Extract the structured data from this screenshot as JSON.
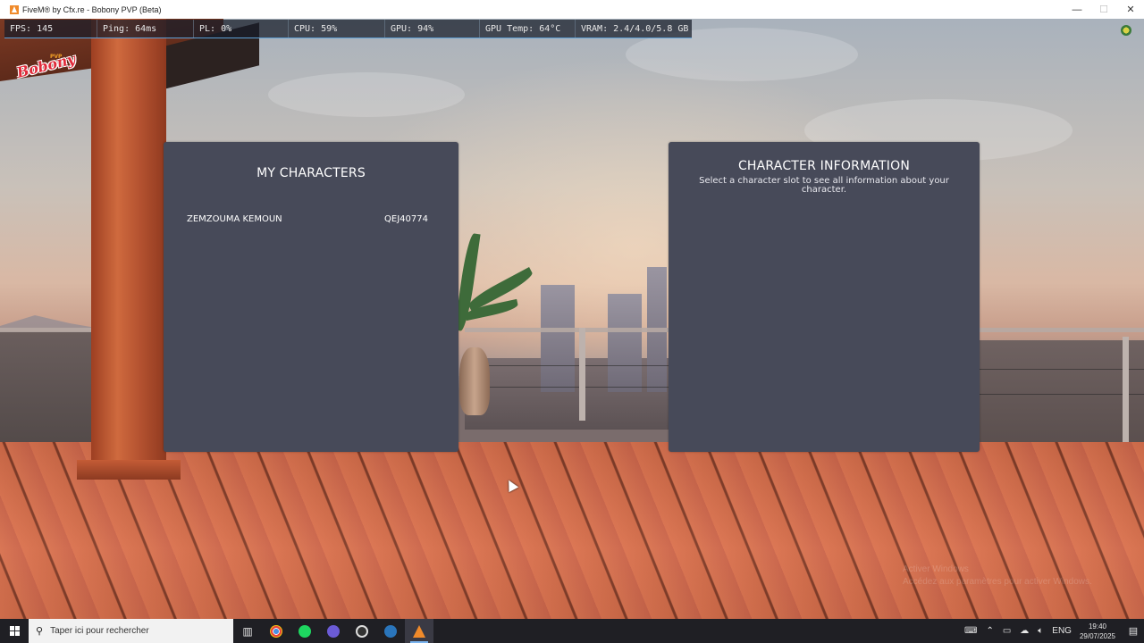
{
  "window": {
    "title": "FiveM® by Cfx.re - Bobony PVP (Beta)",
    "minimize": "—",
    "maximize": "☐",
    "close": "✕"
  },
  "hud": {
    "fps": "FPS: 145",
    "ping": "Ping: 64ms",
    "pl": "PL: 0%",
    "cpu": "CPU: 59%",
    "gpu": "GPU: 94%",
    "gpu_temp": "GPU Temp: 64°C",
    "vram": "VRAM: 2.4/4.0/5.8 GB"
  },
  "logo": {
    "text": "Bobony",
    "sup": "PVP"
  },
  "characters_panel": {
    "title": "MY CHARACTERS",
    "characters": [
      {
        "name": "ZEMZOUMA KEMOUN",
        "id": "QEJ40774"
      }
    ]
  },
  "info_panel": {
    "title": "CHARACTER INFORMATION",
    "subtitle": "Select a character slot to see all information about your character."
  },
  "watermark": {
    "line1": "Activer Windows",
    "line2": "Accédez aux paramètres pour activer Windows."
  },
  "taskbar": {
    "search_placeholder": "Taper ici pour rechercher",
    "apps": [
      {
        "icon": "chrome-icon",
        "color": "#e8453c"
      },
      {
        "icon": "spotify-icon",
        "color": "#1ed760"
      },
      {
        "icon": "discord-icon",
        "color": "#6b5bd6"
      },
      {
        "icon": "obs-icon",
        "color": "#3a3a3a"
      },
      {
        "icon": "steam-icon",
        "color": "#2a75bb"
      },
      {
        "icon": "fivem-icon",
        "color": "#f08a2a"
      }
    ],
    "language": "ENG",
    "time": "19:40",
    "date": "29/07/2025"
  }
}
